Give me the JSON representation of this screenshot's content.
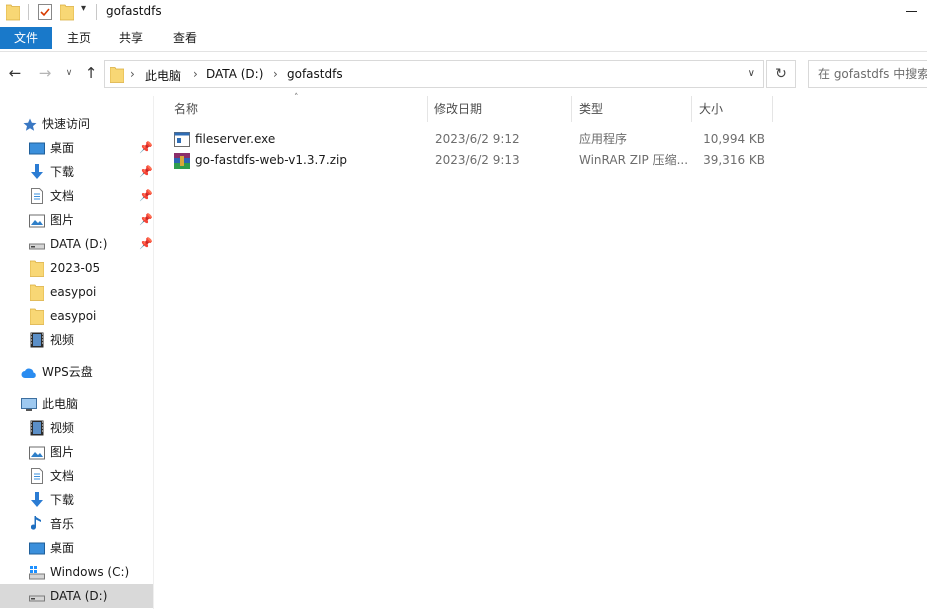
{
  "window": {
    "title": "gofastdfs",
    "quick_access_down": "▾"
  },
  "ribbon": {
    "tabs": [
      {
        "label": "文件"
      },
      {
        "label": "主页"
      },
      {
        "label": "共享"
      },
      {
        "label": "查看"
      }
    ]
  },
  "address": {
    "segments": [
      "此电脑",
      "DATA (D:)",
      "gofastdfs"
    ],
    "search_placeholder": "在 gofastdfs 中搜索"
  },
  "nav": {
    "quick_access": {
      "label": "快速访问"
    },
    "quick_items": [
      {
        "label": "桌面",
        "icon": "desktop-icon",
        "pinned": true
      },
      {
        "label": "下载",
        "icon": "download-icon",
        "pinned": true
      },
      {
        "label": "文档",
        "icon": "document-icon",
        "pinned": true
      },
      {
        "label": "图片",
        "icon": "picture-icon",
        "pinned": true
      },
      {
        "label": "DATA (D:)",
        "icon": "drive-icon",
        "pinned": true
      },
      {
        "label": "2023-05",
        "icon": "folder-icon",
        "pinned": false
      },
      {
        "label": "easypoi",
        "icon": "folder-icon",
        "pinned": false
      },
      {
        "label": "easypoi",
        "icon": "folder-icon",
        "pinned": false
      },
      {
        "label": "视频",
        "icon": "video-icon",
        "pinned": false
      }
    ],
    "wps_cloud": {
      "label": "WPS云盘"
    },
    "this_pc": {
      "label": "此电脑"
    },
    "pc_items": [
      {
        "label": "视频",
        "icon": "video-icon"
      },
      {
        "label": "图片",
        "icon": "picture-icon"
      },
      {
        "label": "文档",
        "icon": "document-icon"
      },
      {
        "label": "下载",
        "icon": "download-icon"
      },
      {
        "label": "音乐",
        "icon": "music-icon"
      },
      {
        "label": "桌面",
        "icon": "desktop-icon"
      },
      {
        "label": "Windows (C:)",
        "icon": "windows-drive-icon"
      },
      {
        "label": "DATA (D:)",
        "icon": "drive-icon",
        "selected": true
      }
    ]
  },
  "columns": {
    "name": "名称",
    "modified": "修改日期",
    "type": "类型",
    "size": "大小"
  },
  "files": [
    {
      "name": "fileserver.exe",
      "modified": "2023/6/2 9:12",
      "type": "应用程序",
      "size": "10,994 KB",
      "icon": "exe-icon"
    },
    {
      "name": "go-fastdfs-web-v1.3.7.zip",
      "modified": "2023/6/2 9:13",
      "type": "WinRAR ZIP 压缩...",
      "size": "39,316 KB",
      "icon": "winrar-zip-icon"
    }
  ],
  "colors": {
    "accent": "#1979ca",
    "folder": "#f8d775",
    "selected_nav": "#d9d9d9"
  }
}
